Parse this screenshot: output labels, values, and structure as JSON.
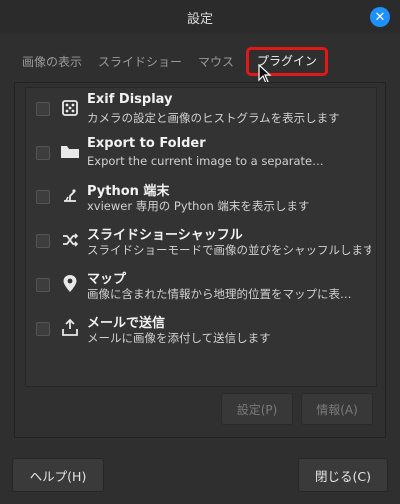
{
  "window": {
    "title": "設定",
    "close_icon": "close-icon"
  },
  "tabs": [
    {
      "label": "画像の表示"
    },
    {
      "label": "スライドショー"
    },
    {
      "label": "マウス"
    },
    {
      "label": "プラグイン"
    }
  ],
  "plugins": [
    {
      "icon": "exif-icon",
      "name": "Exif Display",
      "desc": "カメラの設定と画像のヒストグラムを表示します"
    },
    {
      "icon": "folder-icon",
      "name": "Export to Folder",
      "desc": "Export the current image to a separate…"
    },
    {
      "icon": "python-terminal-icon",
      "name": "Python 端末",
      "desc": "xviewer 専用の Python 端末を表示します"
    },
    {
      "icon": "shuffle-icon",
      "name": "スライドショーシャッフル",
      "desc": "スライドショーモードで画像の並びをシャッフルします"
    },
    {
      "icon": "map-pin-icon",
      "name": "マップ",
      "desc": "画像に含まれた情報から地理的位置をマップに表…"
    },
    {
      "icon": "send-mail-icon",
      "name": "メールで送信",
      "desc": "メールに画像を添付して送信します"
    }
  ],
  "panel_buttons": {
    "settings": "設定(P)",
    "info": "情報(A)"
  },
  "footer": {
    "help": "ヘルプ(H)",
    "close": "閉じる(C)"
  },
  "colors": {
    "accent": "#1e90ff",
    "highlight": "#e01818"
  }
}
